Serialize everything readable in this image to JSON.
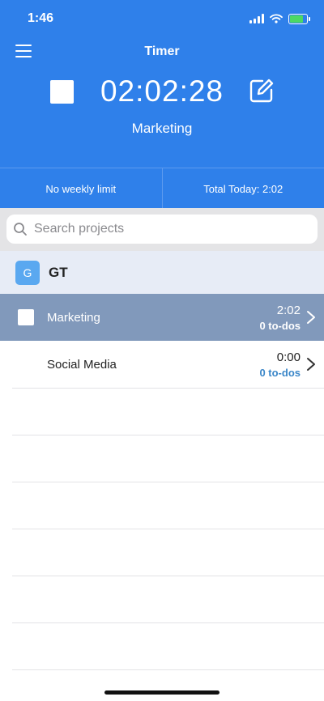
{
  "status_bar": {
    "time": "1:46"
  },
  "header": {
    "title": "Timer",
    "timer": "02:02:28",
    "project": "Marketing"
  },
  "stats": {
    "weekly_limit": "No weekly limit",
    "total_today": "Total Today: 2:02"
  },
  "search": {
    "placeholder": "Search projects"
  },
  "group": {
    "avatar_letter": "G",
    "name": "GT"
  },
  "projects": [
    {
      "name": "Marketing",
      "time": "2:02",
      "todos": "0 to-dos"
    },
    {
      "name": "Social Media",
      "time": "0:00",
      "todos": "0 to-dos"
    }
  ],
  "colors": {
    "header_blue": "#2f80ea",
    "active_row": "#8199bb",
    "todo_link": "#3a86c8",
    "group_bg": "#e7ecf6"
  }
}
